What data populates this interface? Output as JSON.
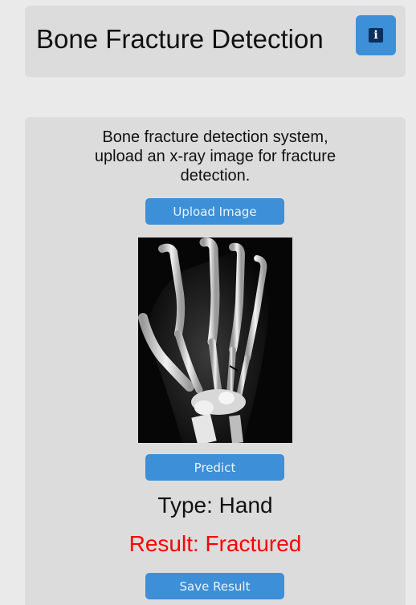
{
  "header": {
    "title": "Bone Fracture Detection",
    "info_icon": "info-icon"
  },
  "main": {
    "description": "Bone fracture detection system, upload an x-ray image for fracture detection.",
    "upload_label": "Upload Image",
    "xray_image": "hand-xray-image",
    "predict_label": "Predict",
    "type_text": "Type: Hand",
    "result_text": "Result: Fractured",
    "save_label": "Save Result"
  },
  "colors": {
    "background": "#eaeaea",
    "card": "#dcdcdc",
    "accent": "#3d8fd8",
    "result": "#ff0000"
  }
}
